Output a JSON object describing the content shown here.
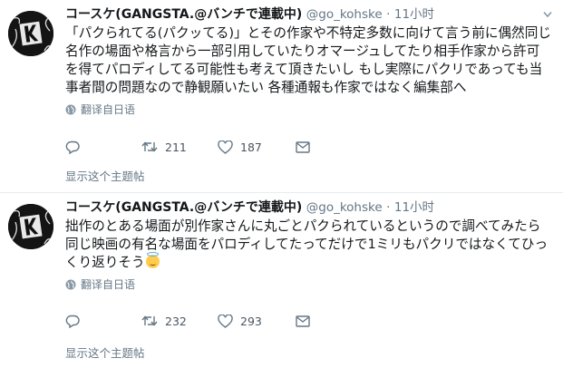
{
  "tweets": [
    {
      "name": "コースケ(GANGSTA.@バンチで連載中)",
      "handle": "@go_kohske",
      "dot": "·",
      "time": "11小时",
      "text": "「パクられてる(パクッてる)」とその作家や不特定多数に向けて言う前に偶然同じ名作の場面や格言から一部引用していたりオマージュしてたり相手作家から許可を得てパロディしてる可能性も考えて頂きたいし もし実際にパクリであっても当事者間の問題なので静観願いたい 各種通報も作家ではなく編集部へ",
      "translate": "翻译自日语",
      "replies": "",
      "retweets": "211",
      "likes": "187",
      "thread": "显示这个主题帖"
    },
    {
      "name": "コースケ(GANGSTA.@バンチで連載中)",
      "handle": "@go_kohske",
      "dot": "·",
      "time": "11小时",
      "text": "拙作のとある場面が別作家さんに丸ごとパクられているというので調べてみたら同じ映画の有名な場面をパロディしてたってだけで1ミリもパクリではなくてひっくり返りそう",
      "emoji": "smiling-face-with-halo",
      "translate": "翻译自日语",
      "replies": "",
      "retweets": "232",
      "likes": "293",
      "thread": "显示这个主题帖"
    }
  ],
  "colors": {
    "text": "#14171a",
    "secondary": "#657786",
    "divider": "#e6ecf0",
    "avatar_bg": "#111111"
  },
  "icons": [
    "avatar-k-logo",
    "chevron-down-icon",
    "globe-icon",
    "reply-icon",
    "retweet-icon",
    "heart-icon",
    "message-icon"
  ]
}
